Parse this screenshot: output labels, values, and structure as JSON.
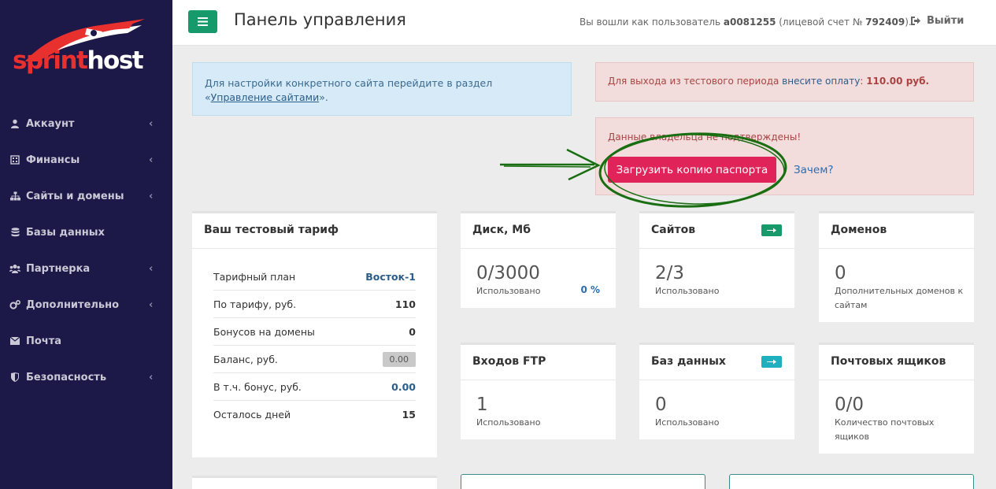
{
  "logo": {
    "part1": "sprint",
    "part2": "host"
  },
  "sidebar": {
    "items": [
      {
        "label": "Аккаунт",
        "icon": "user-icon",
        "has_chevron": true
      },
      {
        "label": "Финансы",
        "icon": "calculator-icon",
        "has_chevron": true
      },
      {
        "label": "Сайты и домены",
        "icon": "sitemap-icon",
        "has_chevron": true
      },
      {
        "label": "Базы данных",
        "icon": "database-icon",
        "has_chevron": false
      },
      {
        "label": "Партнерка",
        "icon": "users-icon",
        "has_chevron": true
      },
      {
        "label": "Дополнительно",
        "icon": "cogs-icon",
        "has_chevron": true
      },
      {
        "label": "Почта",
        "icon": "envelope-icon",
        "has_chevron": false
      },
      {
        "label": "Безопасность",
        "icon": "shield-icon",
        "has_chevron": true
      }
    ]
  },
  "header": {
    "title": "Панель управления",
    "user_prefix": "Вы вошли как пользователь ",
    "username": "a0081255",
    "account_prefix": " (лицевой счет № ",
    "account_no": "792409",
    "account_suffix": ").",
    "logout": "Выйти"
  },
  "alerts": {
    "info_prefix": "Для настройки конкретного сайта перейдите в раздел «",
    "info_link": "Управление сайтами",
    "info_suffix": "».",
    "pay_prefix": "Для выхода из тестового периода ",
    "pay_link": "внесите оплату",
    "pay_colon": ": ",
    "pay_amount": "110.00 руб.",
    "owner_text": "Данные владельца не подтверждены!",
    "upload_button": "Загрузить копию паспорта",
    "why_link": "Зачем?"
  },
  "tariff": {
    "title": "Ваш тестовый тариф",
    "rows": [
      {
        "label": "Тарифный план",
        "value": "Восток-1"
      },
      {
        "label": "По тарифу, руб.",
        "value": "110"
      },
      {
        "label": "Бонусов на домены",
        "value": "0"
      },
      {
        "label": "Баланс, руб.",
        "value": "0.00"
      },
      {
        "label": "В т.ч. бонус, руб.",
        "value": "0.00"
      },
      {
        "label": "Осталось дней",
        "value": "15"
      }
    ]
  },
  "stats": {
    "disk": {
      "title": "Диск, Мб",
      "value": "0/3000",
      "label": "Использовано",
      "pct": "0 %"
    },
    "sites": {
      "title": "Сайтов",
      "value": "2/3",
      "label": "Использовано"
    },
    "domains": {
      "title": "Доменов",
      "value": "0",
      "label": "Дополнительных доменов к сайтам"
    },
    "ftp": {
      "title": "Входов FTP",
      "value": "1",
      "label": "Использовано"
    },
    "db": {
      "title": "Баз данных",
      "value": "0",
      "label": "Использовано"
    },
    "mail": {
      "title": "Почтовых ящиков",
      "value": "0/0",
      "label": "Количество почтовых ящиков"
    }
  },
  "colors": {
    "sidebar_bg": "#1c1848",
    "accent_green": "#179a6b",
    "teal_badge": "#1fb0c0",
    "upload_btn": "#e0245a",
    "annotation": "#1a6e12"
  }
}
